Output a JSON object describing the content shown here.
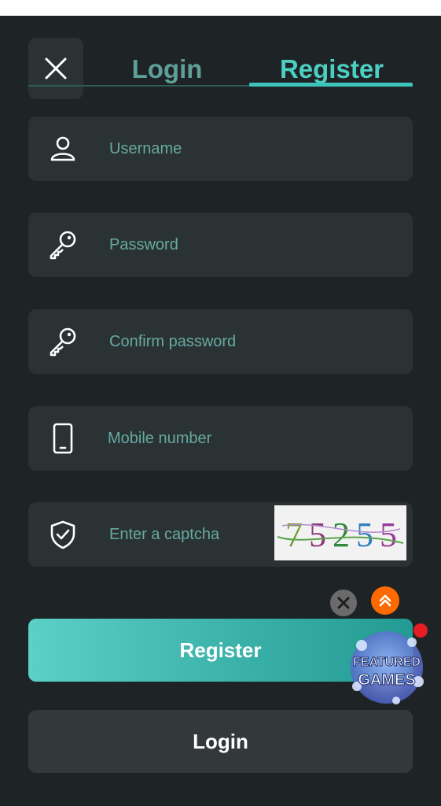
{
  "tabs": {
    "login_label": "Login",
    "register_label": "Register",
    "active": "Register"
  },
  "fields": {
    "username": {
      "placeholder": "Username",
      "icon": "user-icon"
    },
    "password": {
      "placeholder": "Password",
      "icon": "key-icon"
    },
    "confirm_password": {
      "placeholder": "Confirm password",
      "icon": "key-icon"
    },
    "mobile": {
      "placeholder": "Mobile number",
      "icon": "phone-icon"
    },
    "captcha": {
      "placeholder": "Enter a captcha",
      "icon": "shield-check-icon",
      "code": "75255",
      "digit_colors": [
        "#6a9a2a",
        "#8a3a7a",
        "#2e8a3a",
        "#2f7fc0",
        "#9a3a9a"
      ]
    }
  },
  "buttons": {
    "register_label": "Register",
    "login_label": "Login"
  },
  "floating": {
    "featured_line1": "FEATURED",
    "featured_line2": "GAMES"
  },
  "colors": {
    "accent": "#3ec5bb",
    "background": "#1e2426",
    "field": "#2b3234"
  }
}
